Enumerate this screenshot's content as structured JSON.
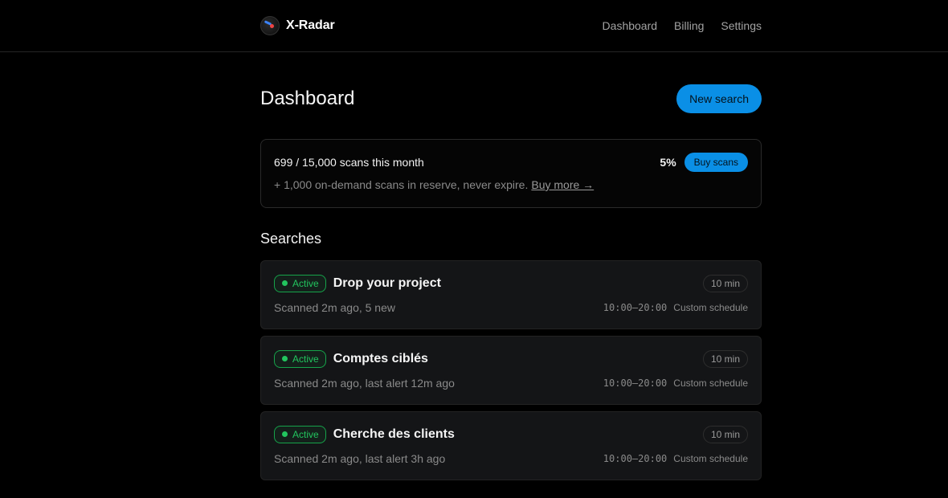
{
  "app": {
    "name": "X-Radar"
  },
  "nav": {
    "items": [
      {
        "label": "Dashboard"
      },
      {
        "label": "Billing"
      },
      {
        "label": "Settings"
      }
    ]
  },
  "page": {
    "title": "Dashboard",
    "new_search_label": "New search"
  },
  "usage": {
    "count_text": "699 / 15,000 scans this month",
    "used": 699,
    "limit": 15000,
    "percent_text": "5%",
    "buy_label": "Buy scans",
    "reserve_text": "+ 1,000 on-demand scans in reserve, never expire.",
    "buy_more_label": "Buy more →"
  },
  "searches": {
    "title": "Searches",
    "items": [
      {
        "status": "Active",
        "name": "Drop your project",
        "interval": "10 min",
        "last_scan": "Scanned 2m ago, 5 new",
        "time_window": "10:00–20:00",
        "schedule_label": "Custom schedule"
      },
      {
        "status": "Active",
        "name": "Comptes ciblés",
        "interval": "10 min",
        "last_scan": "Scanned 2m ago, last alert 12m ago",
        "time_window": "10:00–20:00",
        "schedule_label": "Custom schedule"
      },
      {
        "status": "Active",
        "name": "Cherche des clients",
        "interval": "10 min",
        "last_scan": "Scanned 2m ago, last alert 3h ago",
        "time_window": "10:00–20:00",
        "schedule_label": "Custom schedule"
      }
    ]
  },
  "colors": {
    "accent": "#0a8fe6",
    "active_green": "#22c55e",
    "background": "#000000",
    "card": "#141517"
  },
  "icons": {
    "logo": "radar-logo-icon",
    "status": "status-dot-icon"
  }
}
